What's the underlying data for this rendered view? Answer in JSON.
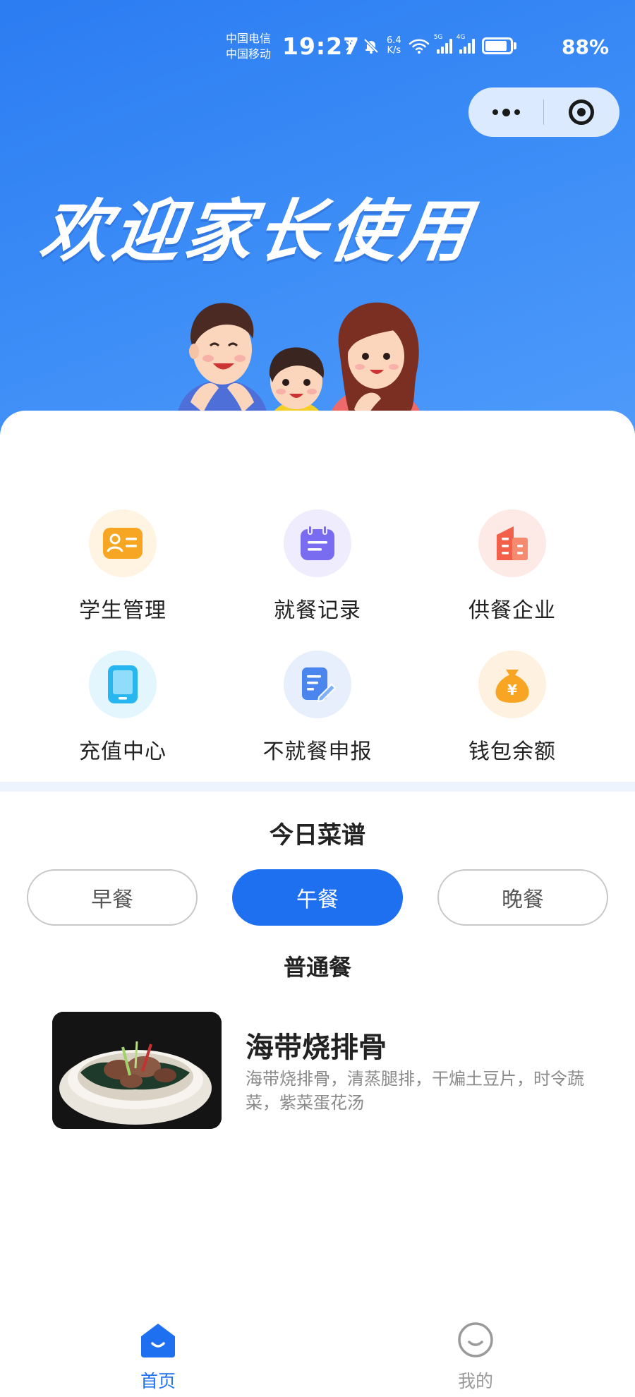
{
  "status_bar": {
    "carrier_1": "中国电信",
    "carrier_2": "中国移动",
    "time": "19:27",
    "net_speed_value": "6.4",
    "net_speed_unit": "K/s",
    "signal_1_tag": "5G",
    "signal_2_tag": "4G",
    "battery_percent": "88%",
    "battery_level": 0.88,
    "icons": [
      "bluetooth-icon",
      "mute-bell-icon",
      "wifi-icon",
      "signal-icon",
      "signal-icon",
      "battery-icon"
    ]
  },
  "mini_program_capsule": {
    "icons": [
      "more-icon",
      "close-target-icon"
    ]
  },
  "banner": {
    "welcome_text": "欢迎家长使用",
    "illustration": "family-illustration"
  },
  "menu_grid": [
    {
      "label": "学生管理",
      "icon": "student-card-icon",
      "color": "#f6a623"
    },
    {
      "label": "就餐记录",
      "icon": "calendar-record-icon",
      "color": "#7a6cf0"
    },
    {
      "label": "供餐企业",
      "icon": "building-icon",
      "color": "#f2604a"
    },
    {
      "label": "充值中心",
      "icon": "tablet-icon",
      "color": "#28b6f0"
    },
    {
      "label": "不就餐申报",
      "icon": "edit-document-icon",
      "color": "#4a86ee"
    },
    {
      "label": "钱包余额",
      "icon": "money-bag-icon",
      "color": "#f7a523"
    }
  ],
  "today_menu": {
    "title": "今日菜谱",
    "tabs": [
      {
        "label": "早餐",
        "active": false
      },
      {
        "label": "午餐",
        "active": true
      },
      {
        "label": "晚餐",
        "active": false
      }
    ],
    "meal_type": "普通餐",
    "dish": {
      "name": "海带烧排骨",
      "description": "海带烧排骨，清蒸腿排，干煸土豆片，时令蔬菜，紫菜蛋花汤"
    }
  },
  "tab_bar": [
    {
      "label": "首页",
      "icon": "home-icon",
      "active": true,
      "color": "#1f70f0"
    },
    {
      "label": "我的",
      "icon": "profile-smile-icon",
      "active": false,
      "color": "#9a9a9a"
    }
  ],
  "colors": {
    "primary": "#1f70f0",
    "header_gradient_start": "#2c7cf2",
    "header_gradient_end": "#4f9bfb",
    "divider": "#eef4fd"
  }
}
